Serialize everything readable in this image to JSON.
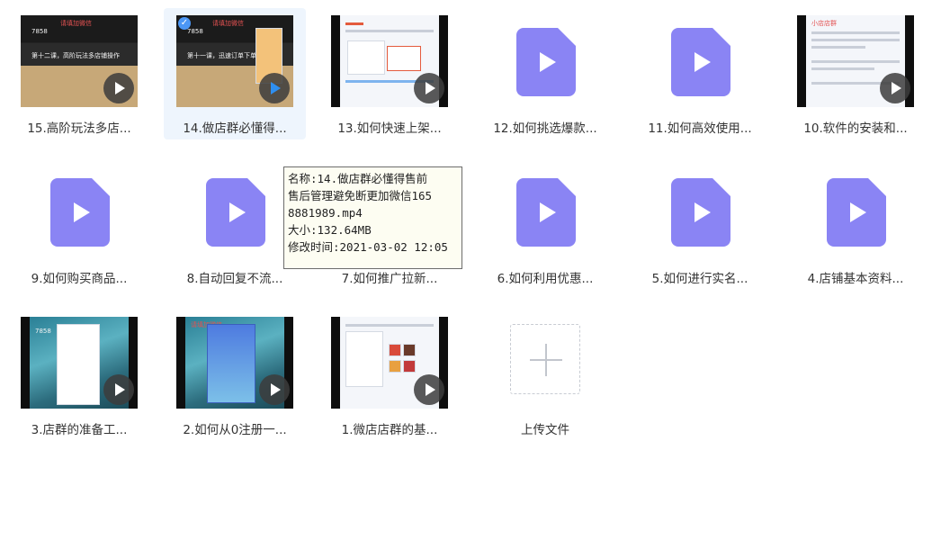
{
  "colors": {
    "file_icon": "#8a84f4",
    "selected_bg": "#eef5fd",
    "play_accent": "#2f8ff0"
  },
  "items": [
    {
      "label": "15.高阶玩法多店...",
      "kind": "video-thumb"
    },
    {
      "label": "14.做店群必懂得...",
      "kind": "video-thumb",
      "selected": true
    },
    {
      "label": "13.如何快速上架...",
      "kind": "video-thumb"
    },
    {
      "label": "12.如何挑选爆款...",
      "kind": "video-icon"
    },
    {
      "label": "11.如何高效使用...",
      "kind": "video-icon"
    },
    {
      "label": "10.软件的安装和...",
      "kind": "video-thumb"
    },
    {
      "label": "9.如何购买商品...",
      "kind": "video-icon"
    },
    {
      "label": "8.自动回复不流...",
      "kind": "video-icon"
    },
    {
      "label": "7.如何推广拉新...",
      "kind": "video-icon"
    },
    {
      "label": "6.如何利用优惠...",
      "kind": "video-icon"
    },
    {
      "label": "5.如何进行实名...",
      "kind": "video-icon"
    },
    {
      "label": "4.店铺基本资料...",
      "kind": "video-icon"
    },
    {
      "label": "3.店群的准备工...",
      "kind": "video-thumb"
    },
    {
      "label": "2.如何从0注册一...",
      "kind": "video-thumb"
    },
    {
      "label": "1.微店店群的基...",
      "kind": "video-thumb"
    }
  ],
  "upload": {
    "label": "上传文件"
  },
  "thumb_text": {
    "t15_top": "请填加微信",
    "t15_id": "7858",
    "t15_sub": "第十二课，高阶玩法多店铺操作",
    "t14_top": "请填加微信",
    "t14_id": "7858",
    "t14_sub": "第十一课，迅速订单下单",
    "t10_top": "小店店群",
    "t3_id": "7858",
    "t2_top": "请填加微信"
  },
  "tooltip": {
    "line1": "名称:14.做店群必懂得售前",
    "line2": "售后管理避免断更加微信165",
    "line3": "8881989.mp4",
    "line4": "大小:132.64MB",
    "line5": "修改时间:2021-03-02 12:05"
  }
}
